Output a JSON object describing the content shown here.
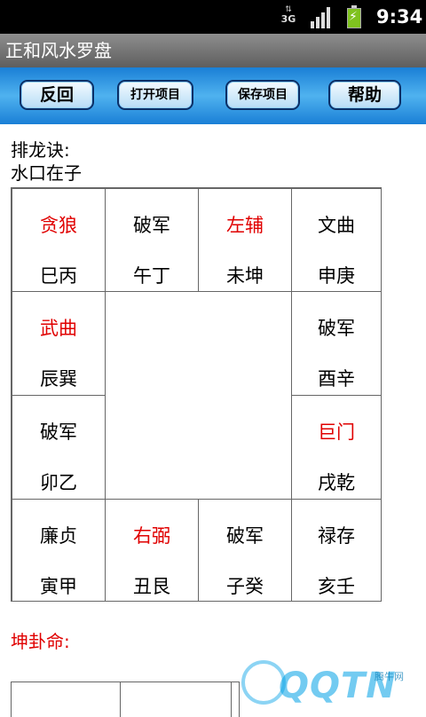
{
  "status_bar": {
    "network": "3G",
    "time": "9:34"
  },
  "app": {
    "title": "正和风水罗盘"
  },
  "toolbar": {
    "back_label": "反回",
    "open_label": "打开项目",
    "save_label": "保存项目",
    "help_label": "帮助"
  },
  "content": {
    "heading": "排龙诀:",
    "subheading": "水口在子",
    "grid": [
      {
        "star": "贪狼",
        "gua": "巳丙",
        "highlight": true
      },
      {
        "star": "破军",
        "gua": "午丁",
        "highlight": false
      },
      {
        "star": "左辅",
        "gua": "未坤",
        "highlight": true
      },
      {
        "star": "文曲",
        "gua": "申庚",
        "highlight": false
      },
      {
        "star": "武曲",
        "gua": "辰巽",
        "highlight": true
      },
      {
        "star": "破军",
        "gua": "酉辛",
        "highlight": false
      },
      {
        "star": "破军",
        "gua": "卯乙",
        "highlight": false
      },
      {
        "star": "巨门",
        "gua": "戌乾",
        "highlight": true
      },
      {
        "star": "廉贞",
        "gua": "寅甲",
        "highlight": false
      },
      {
        "star": "右弼",
        "gua": "丑艮",
        "highlight": true
      },
      {
        "star": "破军",
        "gua": "子癸",
        "highlight": false
      },
      {
        "star": "禄存",
        "gua": "亥壬",
        "highlight": false
      }
    ],
    "kun_label": "坤卦命:"
  },
  "watermark": {
    "brand": "QQTN",
    "small": "腾牛网"
  },
  "colors": {
    "highlight": "#e00000",
    "toolbar": "#1a7fd6"
  }
}
